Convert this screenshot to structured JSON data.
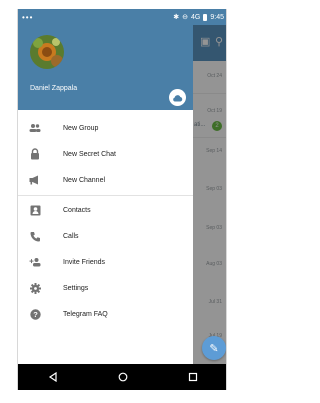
{
  "status_bar": {
    "notification_dots": "•••",
    "time": "9:45",
    "signal_label": "4G"
  },
  "drawer": {
    "user_name": "Daniel Zappala",
    "menu_group_1": [
      {
        "label": "New Group",
        "icon": "group-icon"
      },
      {
        "label": "New Secret Chat",
        "icon": "lock-icon"
      },
      {
        "label": "New Channel",
        "icon": "megaphone-icon"
      }
    ],
    "menu_group_2": [
      {
        "label": "Contacts",
        "icon": "contact-card-icon"
      },
      {
        "label": "Calls",
        "icon": "phone-icon"
      },
      {
        "label": "Invite Friends",
        "icon": "add-person-icon"
      },
      {
        "label": "Settings",
        "icon": "gear-icon"
      },
      {
        "label": "Telegram FAQ",
        "icon": "question-icon"
      }
    ]
  },
  "chat_list_behind": {
    "dates": [
      "Oct 24",
      "Oct 19",
      "Sep 14",
      "Sep 03",
      "Sep 03",
      "Aug 03",
      "Jul 31",
      "Jul 19"
    ],
    "snippet": "ati...",
    "unread_count": "2"
  },
  "colors": {
    "header_blue": "#4a7fa7",
    "toolbar_blue": "#5b95c2",
    "fab_blue": "#5d9cd6",
    "unread_green": "#6cbd45"
  }
}
